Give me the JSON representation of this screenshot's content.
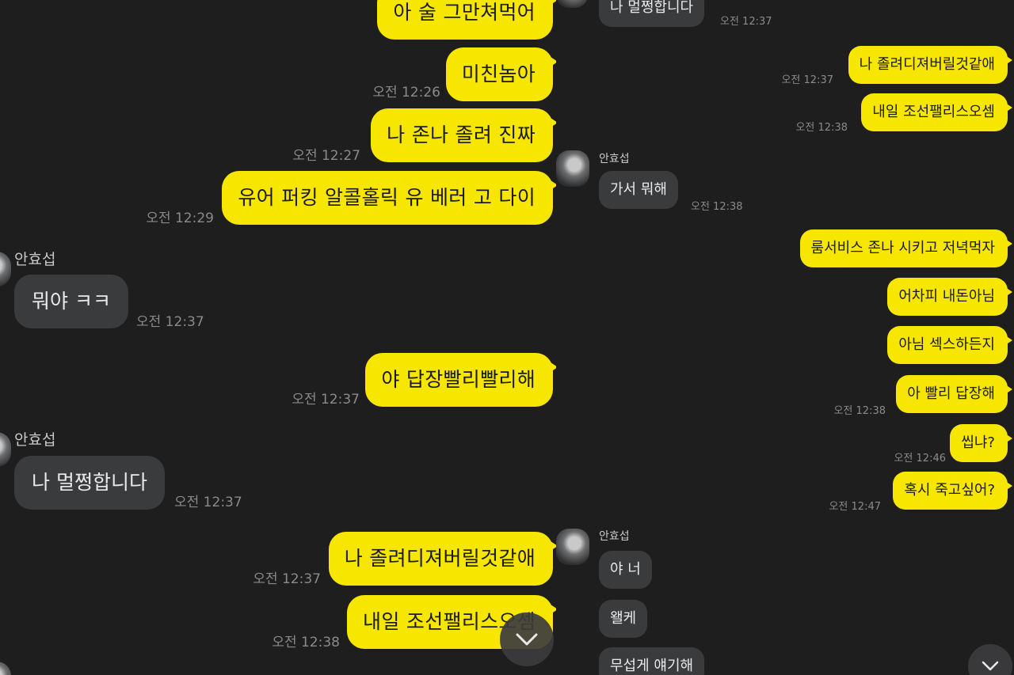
{
  "left": {
    "messages": [
      {
        "text": "아 술 그만쳐먹어"
      },
      {
        "text": "미친놈아",
        "time": "오전 12:26"
      },
      {
        "text": "나 존나 졸려 진짜",
        "time": "오전 12:27"
      },
      {
        "text": "유어 퍼킹 알콜홀릭 유 베러 고 다이",
        "time": "오전 12:29"
      },
      {
        "sender": "안효섭",
        "text": "뭐야 ㅋㅋ",
        "time": "오전 12:37"
      },
      {
        "text": "야 답장빨리빨리해",
        "time": "오전 12:37"
      },
      {
        "sender": "안효섭",
        "text": "나 멀쩡합니다",
        "time": "오전 12:37"
      },
      {
        "text": "나 졸려디져버릴것같애",
        "time": "오전 12:37"
      },
      {
        "text": "내일 조선팰리스오셈",
        "time": "오전 12:38"
      }
    ]
  },
  "right": {
    "messages": [
      {
        "text": "나 멀쩡합니다",
        "time": "오전 12:37"
      },
      {
        "text": "나 졸려디져버릴것같애",
        "time": "오전 12:37"
      },
      {
        "text": "내일 조선팰리스오셈",
        "time": "오전 12:38"
      },
      {
        "sender": "안효섭",
        "text": "가서 뭐해",
        "time": "오전 12:38"
      },
      {
        "text": "룸서비스 존나 시키고 저녁먹자"
      },
      {
        "text": "어차피 내돈아님"
      },
      {
        "text": "아님 섹스하든지"
      },
      {
        "text": "아 빨리 답장해",
        "time": "오전 12:38"
      },
      {
        "text": "씹냐?",
        "time": "오전 12:46"
      },
      {
        "text": "혹시 죽고싶어?",
        "time": "오전 12:47"
      },
      {
        "sender": "안효섭",
        "text": "야 너"
      },
      {
        "text": "왤케"
      },
      {
        "text": "무섭게 얘기해"
      }
    ]
  },
  "icons": {
    "scroll_down": "chevron-down-icon",
    "avatar": "profile-photo"
  },
  "colors": {
    "background": "#1e1e1f",
    "my_bubble": "#f7e600",
    "their_bubble": "#3a3b3d",
    "timestamp": "#8a8a8c"
  }
}
